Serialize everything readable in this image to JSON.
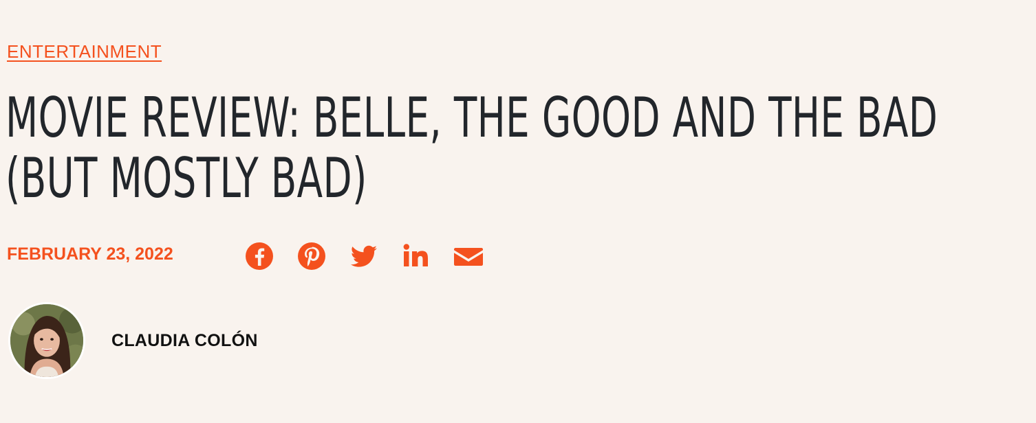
{
  "article": {
    "category": "ENTERTAINMENT",
    "title_line1": "MOVIE REVIEW: BELLE, THE GOOD AND THE BAD",
    "title_line2": "(BUT MOSTLY BAD)",
    "date": "FEBRUARY 23, 2022",
    "author": "CLAUDIA COLÓN"
  },
  "share": {
    "icons": [
      "facebook-icon",
      "pinterest-icon",
      "twitter-icon",
      "linkedin-icon",
      "email-icon"
    ]
  },
  "colors": {
    "accent": "#f4511e",
    "background": "#f9f3ee",
    "text": "#22262b"
  }
}
